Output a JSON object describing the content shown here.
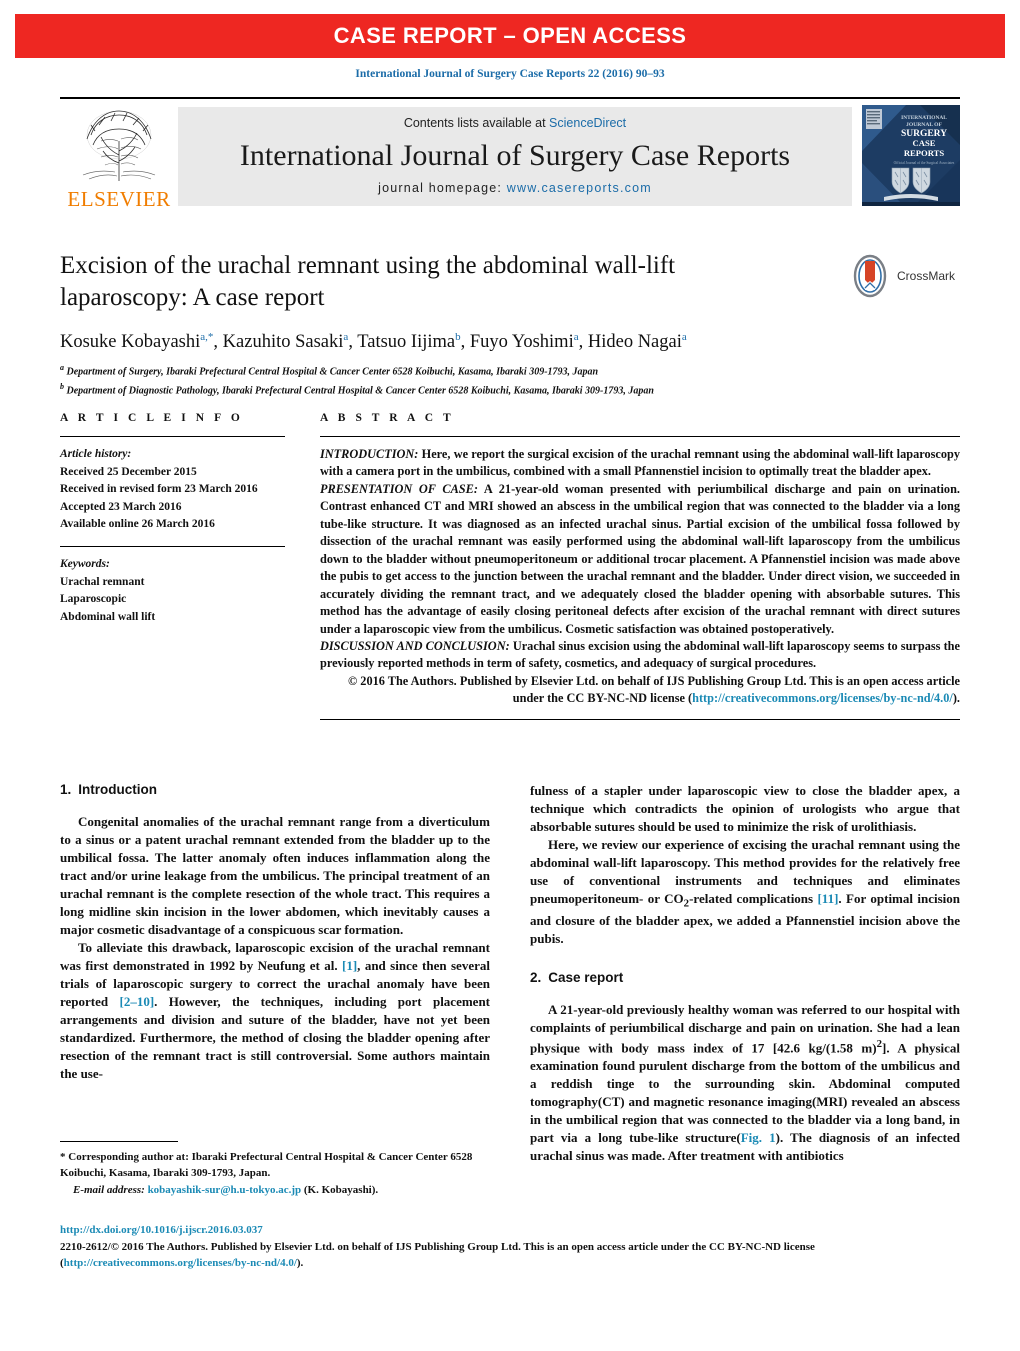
{
  "banner": {
    "label": "CASE REPORT – OPEN ACCESS",
    "color": "#ee2722"
  },
  "citation": "International Journal of Surgery Case Reports 22 (2016) 90–93",
  "masthead": {
    "publisher": "ELSEVIER",
    "contents_prefix": "Contents lists available at ",
    "contents_link": "ScienceDirect",
    "journal_title": "International Journal of Surgery Case Reports",
    "homepage_prefix": "journal homepage: ",
    "homepage_url": "www.casereports.com",
    "cover": {
      "line1": "INTERNATIONAL",
      "line2": "JOURNAL OF",
      "line3": "SURGERY",
      "line4": "CASE",
      "line5": "REPORTS"
    }
  },
  "article": {
    "title": "Excision of the urachal remnant using the abdominal wall-lift laparoscopy: A case report",
    "crossmark_label": "CrossMark",
    "authors_html": "Kosuke Kobayashi<sup>a,*</sup>, Kazuhito Sasaki<sup>a</sup>, Tatsuo Iijima<sup>b</sup>, Fuyo Yoshimi<sup>a</sup>, Hideo Nagai<sup>a</sup>",
    "affiliations": [
      "a Department of Surgery, Ibaraki Prefectural Central Hospital & Cancer Center 6528 Koibuchi, Kasama, Ibaraki 309-1793, Japan",
      "b Department of Diagnostic Pathology, Ibaraki Prefectural Central Hospital & Cancer Center 6528 Koibuchi, Kasama, Ibaraki 309-1793, Japan"
    ]
  },
  "info": {
    "heading": "A R T I C L E    I N F O",
    "history_label": "Article history:",
    "history": [
      "Received 25 December 2015",
      "Received in revised form 23 March 2016",
      "Accepted 23 March 2016",
      "Available online 26 March 2016"
    ],
    "keywords_label": "Keywords:",
    "keywords": [
      "Urachal remnant",
      "Laparoscopic",
      "Abdominal wall lift"
    ]
  },
  "abstract": {
    "heading": "A B S T R A C T",
    "introduction_label": "INTRODUCTION:",
    "introduction_text": " Here, we report the surgical excision of the urachal remnant using the abdominal wall-lift laparoscopy with a camera port in the umbilicus, combined with a small Pfannenstiel incision to optimally treat the bladder apex.",
    "presentation_label": "PRESENTATION OF CASE:",
    "presentation_text": " A 21-year-old woman presented with periumbilical discharge and pain on urination. Contrast enhanced CT and MRI showed an abscess in the umbilical region that was connected to the bladder via a long tube-like structure. It was diagnosed as an infected urachal sinus. Partial excision of the umbilical fossa followed by dissection of the urachal remnant was easily performed using the abdominal wall-lift laparoscopy from the umbilicus down to the bladder without pneumoperitoneum or additional trocar placement. A Pfannenstiel incision was made above the pubis to get access to the junction between the urachal remnant and the bladder. Under direct vision, we succeeded in accurately dividing the remnant tract, and we adequately closed the bladder opening with absorbable sutures. This method has the advantage of easily closing peritoneal defects after excision of the urachal remnant with direct sutures under a laparoscopic view from the umbilicus. Cosmetic satisfaction was obtained postoperatively.",
    "conclusion_label": "DISCUSSION AND CONCLUSION:",
    "conclusion_text": " Urachal sinus excision using the abdominal wall-lift laparoscopy seems to surpass the previously reported methods in term of safety, cosmetics, and adequacy of surgical procedures.",
    "copyright_text": "© 2016 The Authors. Published by Elsevier Ltd. on behalf of IJS Publishing Group Ltd. This is an open access article under the CC BY-NC-ND license (",
    "copyright_link": "http://creativecommons.org/licenses/by-nc-nd/4.0/",
    "copyright_tail": ")."
  },
  "sections": {
    "intro_num": "1.",
    "intro_title": "Introduction",
    "intro_p1": "Congenital anomalies of the urachal remnant range from a diverticulum to a sinus or a patent urachal remnant extended from the bladder up to the umbilical fossa. The latter anomaly often induces inflammation along the tract and/or urine leakage from the umbilicus. The principal treatment of an urachal remnant is the complete resection of the whole tract. This requires a long midline skin incision in the lower abdomen, which inevitably causes a major cosmetic disadvantage of a conspicuous scar formation.",
    "intro_p2_a": "To alleviate this drawback, laparoscopic excision of the urachal remnant was first demonstrated in 1992 by Neufung et al. ",
    "intro_p2_ref1": "[1]",
    "intro_p2_b": ", and since then several trials of laparoscopic surgery to correct the urachal anomaly have been reported ",
    "intro_p2_ref2": "[2–10]",
    "intro_p2_c": ". However, the techniques, including port placement arrangements and division and suture of the bladder, have not yet been standardized. Furthermore, the method of closing the bladder opening after resection of the remnant tract is still controversial. Some authors maintain the use-",
    "right_p1": "fulness of a stapler under laparoscopic view to close the bladder apex, a technique which contradicts the opinion of urologists who argue that absorbable sutures should be used to minimize the risk of urolithiasis.",
    "right_p2_a": "Here, we review our experience of excising the urachal remnant using the abdominal wall-lift laparoscopy. This method provides for the relatively free use of conventional instruments and techniques and eliminates pneumoperitoneum- or CO",
    "right_p2_sub": "2",
    "right_p2_b": "-related complications ",
    "right_p2_ref": "[11]",
    "right_p2_c": ". For optimal incision and closure of the bladder apex, we added a Pfannenstiel incision above the pubis.",
    "case_num": "2.",
    "case_title": "Case report",
    "case_p1_a": "A 21-year-old previously healthy woman was referred to our hospital with complaints of periumbilical discharge and pain on urination. She had a lean physique with body mass index of 17 [42.6 kg/(1.58 m)",
    "case_p1_sup": "2",
    "case_p1_b": "]. A physical examination found purulent discharge from the bottom of the umbilicus and a reddish tinge to the surrounding skin. Abdominal computed tomography(CT) and magnetic resonance imaging(MRI) revealed an abscess in the umbilical region that was connected to the bladder via a long band, in part via a long tube-like structure(",
    "case_p1_figref": "Fig. 1",
    "case_p1_c": "). The diagnosis of an infected urachal sinus was made. After treatment with antibiotics"
  },
  "footnote": {
    "corresponding": "* Corresponding author at: Ibaraki Prefectural Central Hospital & Cancer Center 6528 Koibuchi, Kasama, Ibaraki 309-1793, Japan.",
    "email_label": "E-mail address:",
    "email": "kobayashik-sur@h.u-tokyo.ac.jp",
    "email_owner": "(K. Kobayashi)."
  },
  "footer": {
    "doi": "http://dx.doi.org/10.1016/j.ijscr.2016.03.037",
    "issn_text": "2210-2612/© 2016 The Authors. Published by Elsevier Ltd. on behalf of IJS Publishing Group Ltd. This is an open access article under the CC BY-NC-ND license (",
    "license_link": "http://creativecommons.org/licenses/by-nc-nd/4.0/",
    "license_tail": ")."
  }
}
